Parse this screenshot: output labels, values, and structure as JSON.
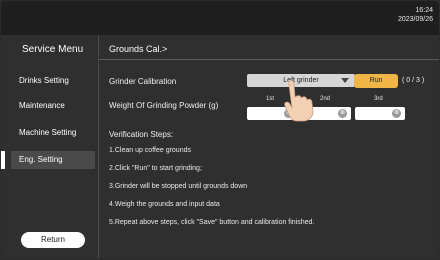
{
  "status_bar": {
    "time": "16:24",
    "date": "2023/09/26"
  },
  "sidebar": {
    "title": "Service Menu",
    "items": [
      {
        "label": "Drinks Setting"
      },
      {
        "label": "Maintenance"
      },
      {
        "label": "Machine Setting"
      },
      {
        "label": "Eng. Setting",
        "active": true
      }
    ],
    "return_label": "Return"
  },
  "main": {
    "page_title": "Grounds Cal.>",
    "grinder_calibration_label": "Grinder Calibration",
    "grinder_select": {
      "value": "Left grinder"
    },
    "run_label": "Run",
    "run_counter": "( 0 / 3 )",
    "weight_label": "Weight Of Grinding Powder (g)",
    "columns": [
      "1st",
      "2nd",
      "3rd"
    ],
    "fields": [
      {
        "value": "",
        "clear_icon": "clear-circle-icon"
      },
      {
        "value": "",
        "clear_icon": "clear-circle-icon"
      },
      {
        "value": "",
        "clear_icon": "clear-circle-icon"
      }
    ],
    "verification_title": "Verification Steps:",
    "steps": [
      "1.Clean up coffee grounds",
      "2.Click \"Run\" to start grinding;",
      "3.Grinder will be stopped until grounds down",
      "4.Weigh the grounds and input data",
      "5.Repeat above steps, click \"Save\" button and calibration finished."
    ]
  },
  "colors": {
    "accent": "#f0b447",
    "background": "#2f2f2f",
    "topbar": "#1f1f1f"
  }
}
